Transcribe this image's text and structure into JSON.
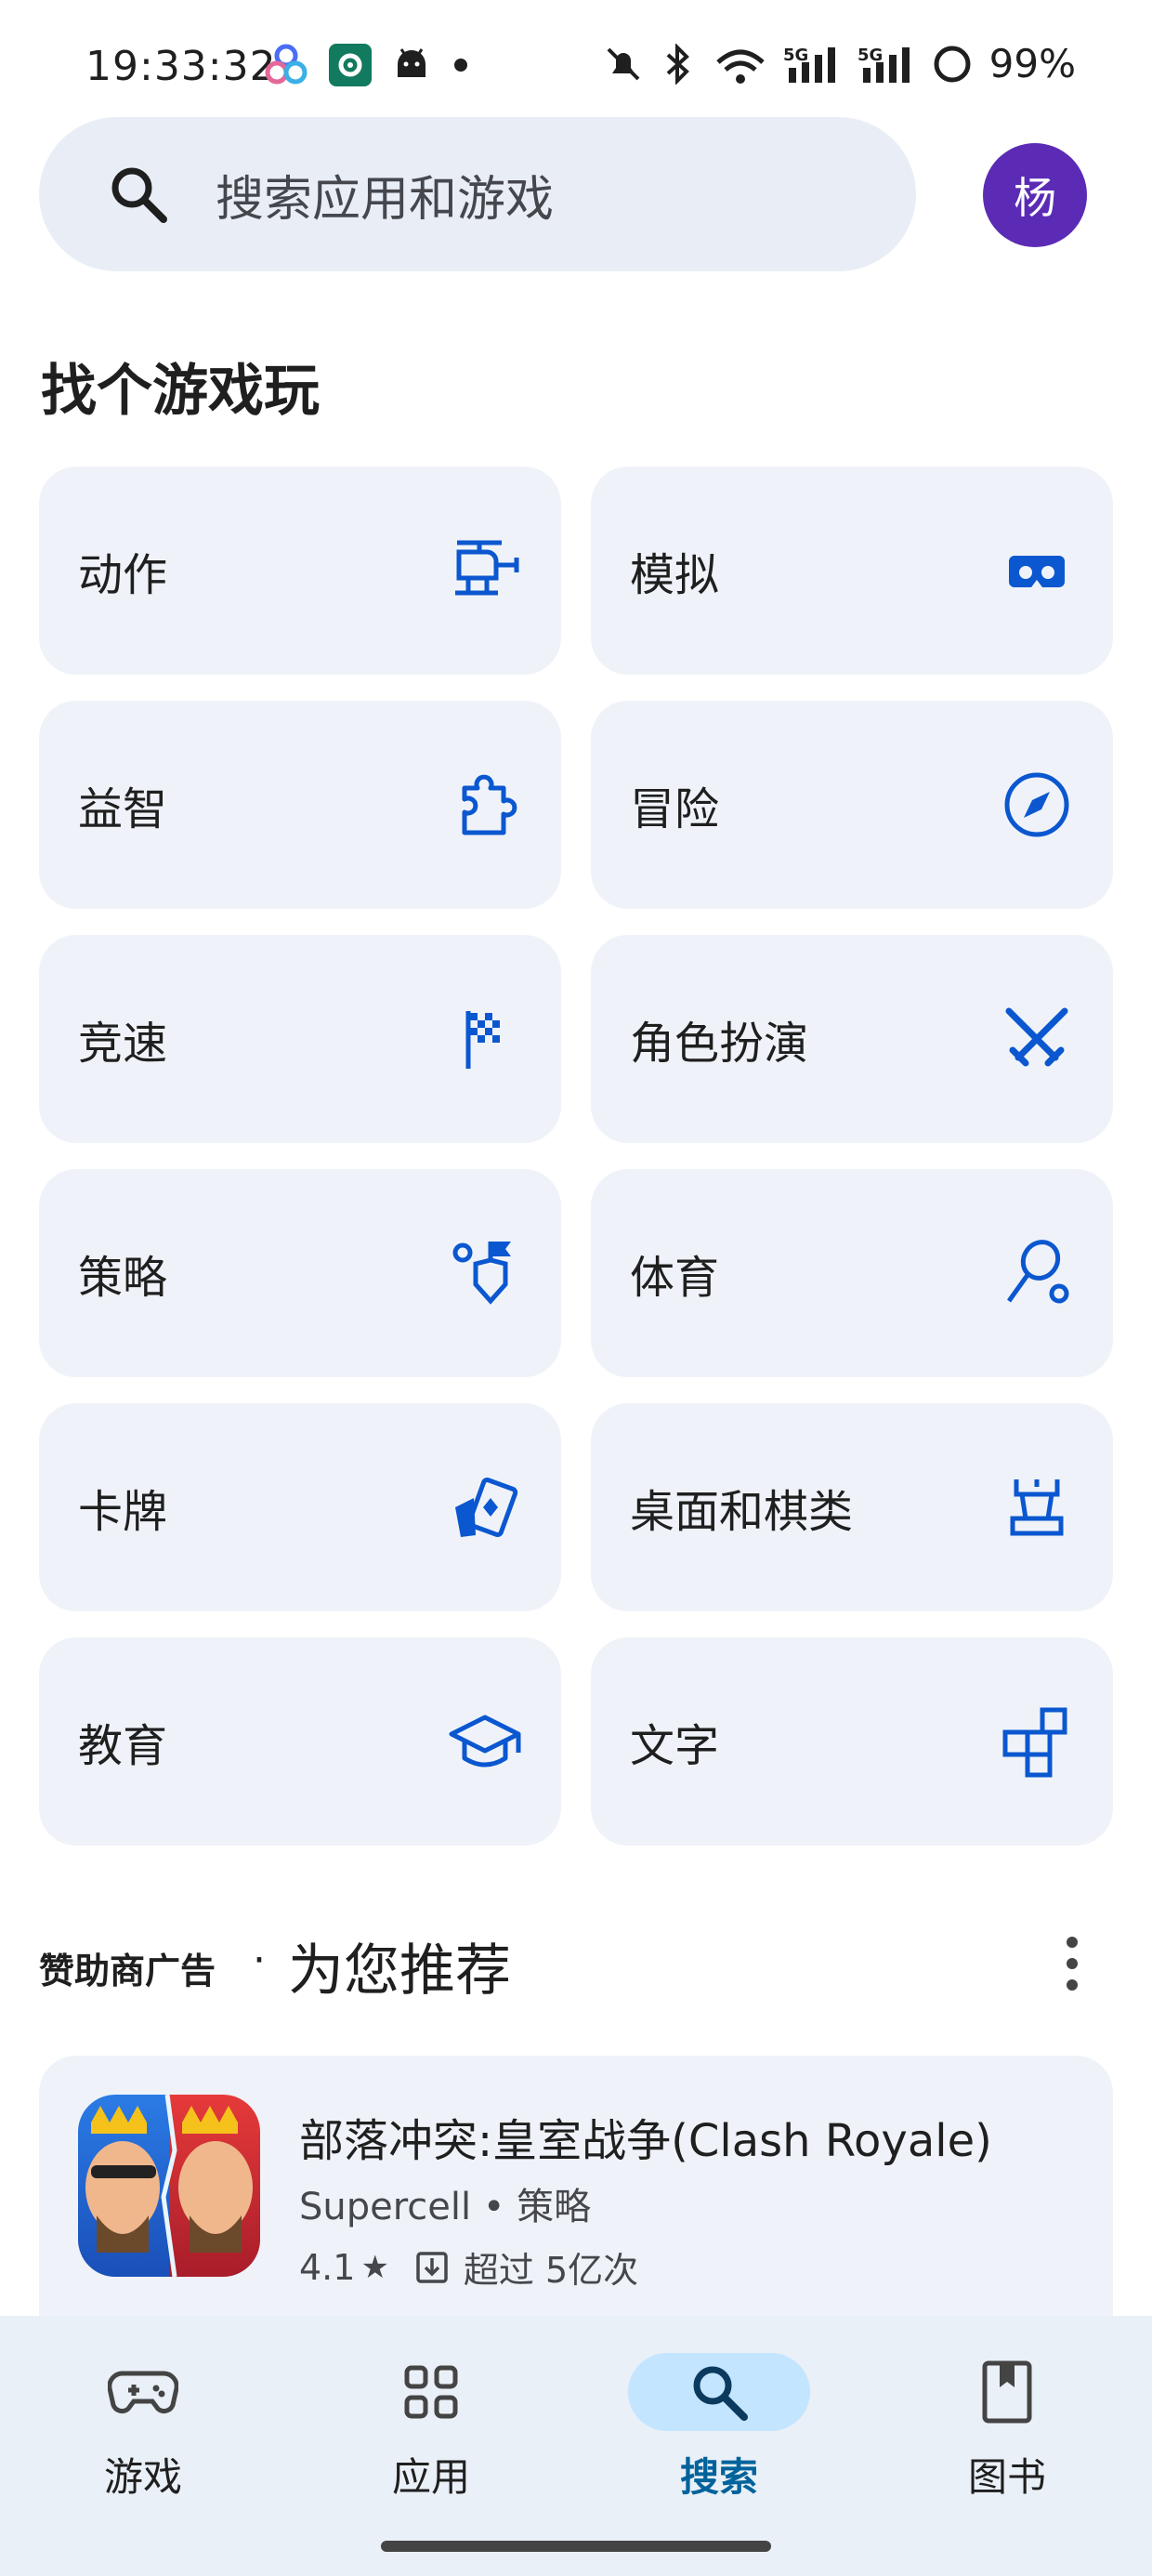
{
  "status_bar": {
    "time": "19:33:32",
    "battery": "99%",
    "icons": [
      "app-cluster-icon",
      "settings-gear-icon",
      "android-icon",
      "notification-dot-icon",
      "mute-icon",
      "bluetooth-icon",
      "wifi-icon",
      "signal-5g-icon",
      "signal-5g-icon",
      "battery-icon"
    ]
  },
  "search": {
    "placeholder": "搜索应用和游戏",
    "avatar_initial": "杨"
  },
  "section_title": "找个游戏玩",
  "genres": [
    {
      "label": "动作",
      "icon": "helicopter-icon"
    },
    {
      "label": "模拟",
      "icon": "vr-headset-icon"
    },
    {
      "label": "益智",
      "icon": "puzzle-piece-icon"
    },
    {
      "label": "冒险",
      "icon": "compass-icon"
    },
    {
      "label": "竞速",
      "icon": "checkered-flag-icon"
    },
    {
      "label": "角色扮演",
      "icon": "crossed-swords-icon"
    },
    {
      "label": "策略",
      "icon": "strategy-flag-icon"
    },
    {
      "label": "体育",
      "icon": "racket-icon"
    },
    {
      "label": "卡牌",
      "icon": "playing-cards-icon"
    },
    {
      "label": "桌面和棋类",
      "icon": "chess-rook-icon"
    },
    {
      "label": "教育",
      "icon": "graduation-cap-icon"
    },
    {
      "label": "文字",
      "icon": "word-tiles-icon"
    }
  ],
  "recommend": {
    "sponsor": "赞助商广告",
    "title": "为您推荐"
  },
  "app": {
    "name": "部落冲突:皇室战争(Clash Royale)",
    "developer": "Supercell",
    "category": "策略",
    "rating": "4.1",
    "downloads": "超过 5亿次"
  },
  "nav": [
    {
      "label": "游戏",
      "icon": "gamepad-icon",
      "active": false
    },
    {
      "label": "应用",
      "icon": "apps-grid-icon",
      "active": false
    },
    {
      "label": "搜索",
      "icon": "search-icon",
      "active": true
    },
    {
      "label": "图书",
      "icon": "book-icon",
      "active": false
    }
  ],
  "colors": {
    "accent": "#00639b",
    "icon_blue": "#0b57d0",
    "card_bg": "#eff3f9",
    "avatar_bg": "#5b2bb5"
  }
}
